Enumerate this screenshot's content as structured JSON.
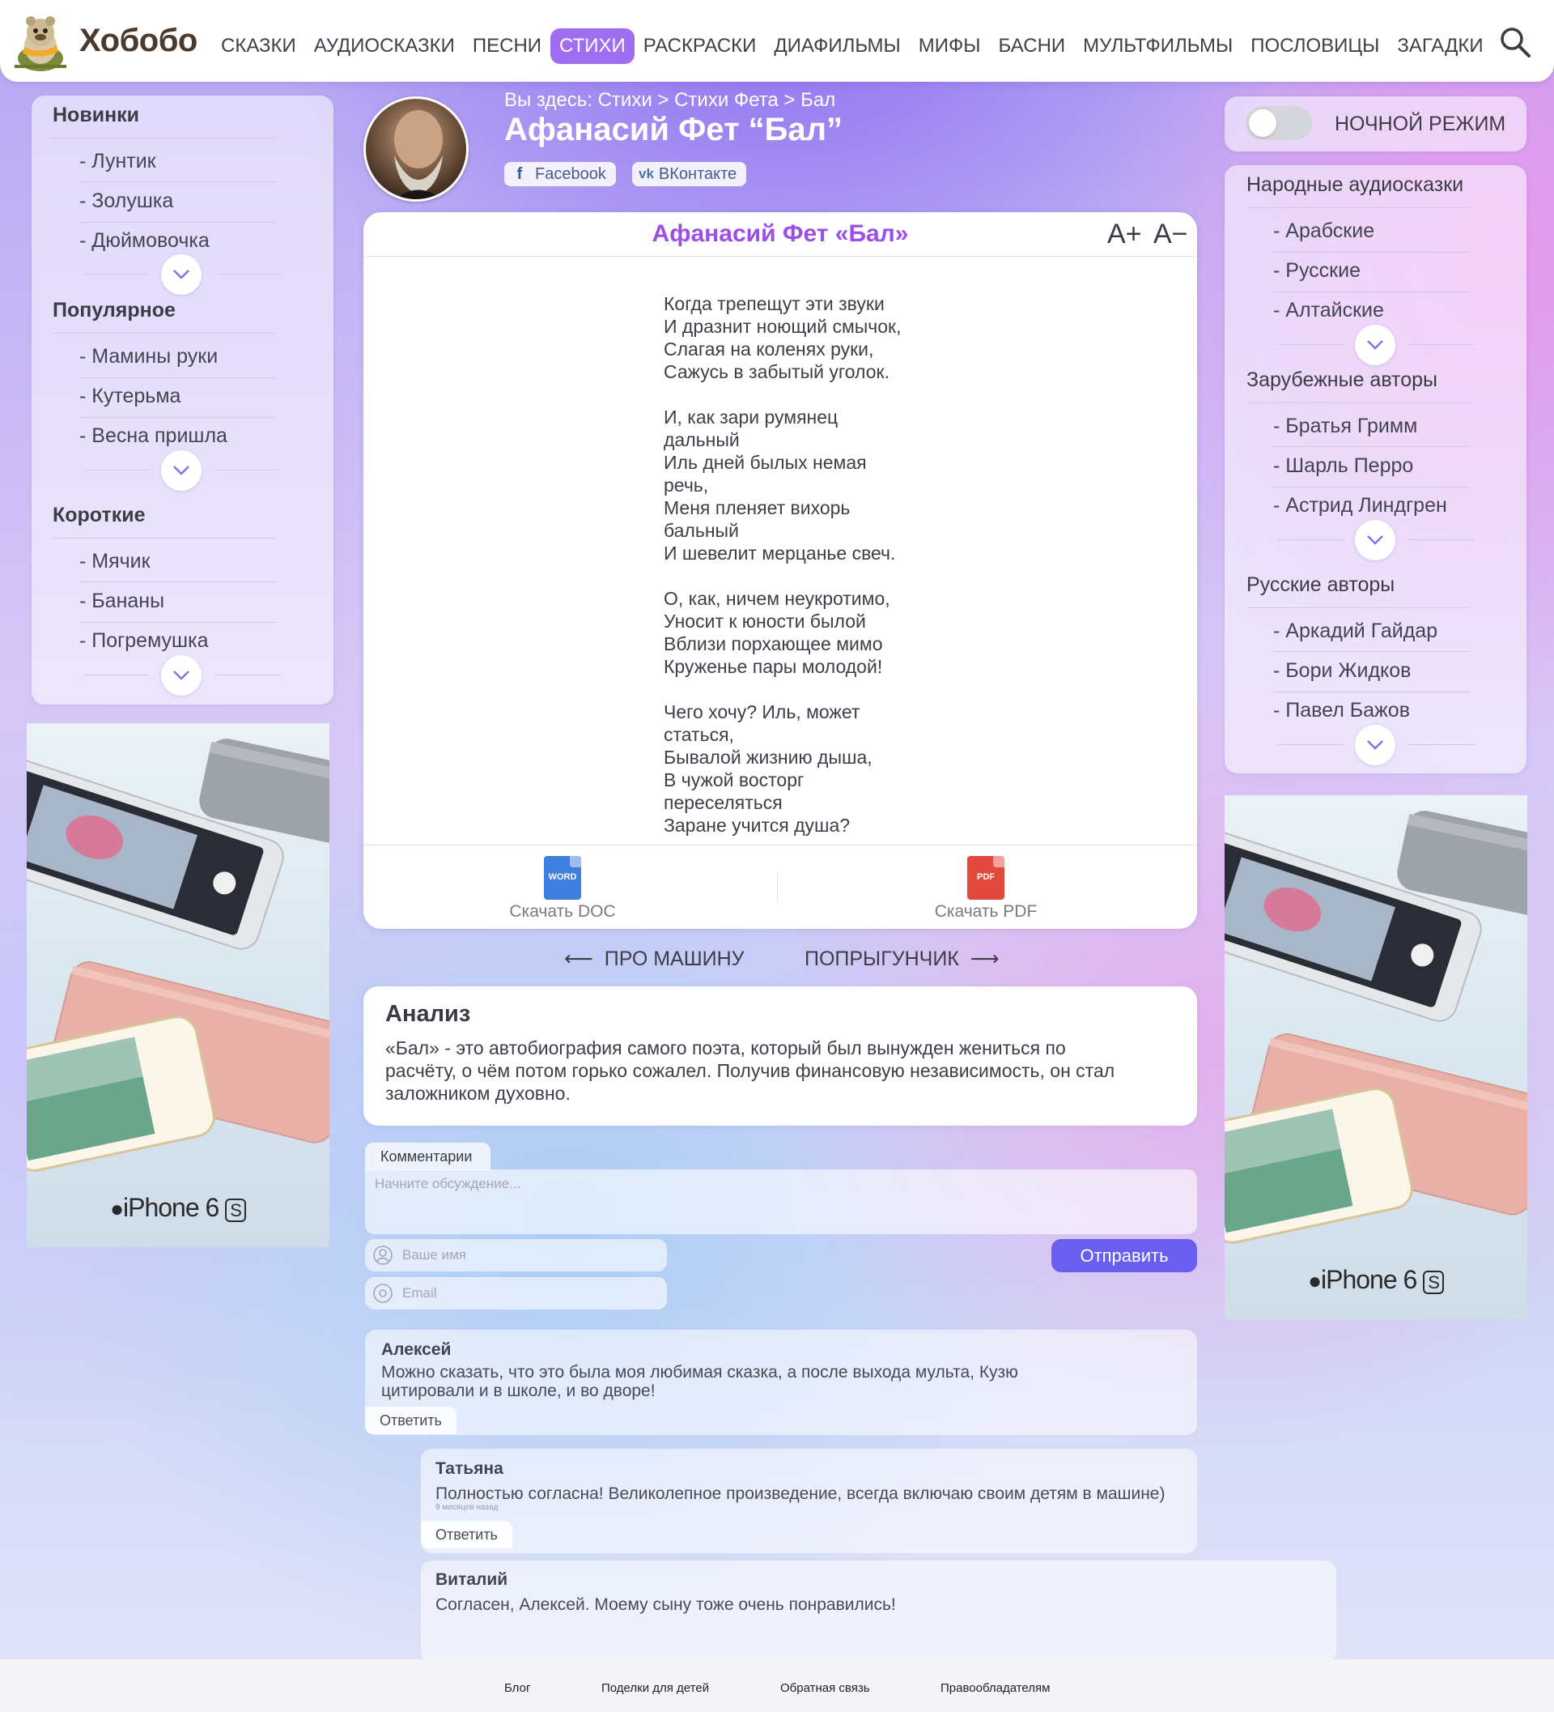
{
  "brand": {
    "name": "Хобобо"
  },
  "nav": {
    "items": [
      "СКАЗКИ",
      "АУДИОСКАЗКИ",
      "ПЕСНИ",
      "СТИХИ",
      "РАСКРАСКИ",
      "ДИАФИЛЬМЫ",
      "МИФЫ",
      "БАСНИ",
      "МУЛЬТФИЛЬМЫ",
      "ПОСЛОВИЦЫ",
      "ЗАГАДКИ"
    ],
    "active": "СТИХИ",
    "search_icon": "search-icon"
  },
  "left_sidebar": {
    "sections": [
      {
        "title": "Новинки",
        "items": [
          "- Лунтик",
          "- Золушка",
          "- Дюймовочка"
        ]
      },
      {
        "title": "Популярное",
        "items": [
          "- Мамины руки",
          "- Кутерьма",
          "- Весна пришла"
        ]
      },
      {
        "title": "Короткие",
        "items": [
          "- Мячик",
          "- Бананы",
          "- Погремушка"
        ]
      }
    ]
  },
  "right_sidebar": {
    "night_mode_label": "НОЧНОЙ РЕЖИМ",
    "night_mode_on": false,
    "sections": [
      {
        "title": "Народные аудиосказки",
        "items": [
          "- Арабские",
          "- Русские",
          "- Алтайские"
        ]
      },
      {
        "title": "Зарубежные авторы",
        "items": [
          "- Братья Гримм",
          "- Шарль Перро",
          "- Астрид Линдгрен"
        ]
      },
      {
        "title": "Русские авторы",
        "items": [
          "- Аркадий Гайдар",
          "- Бори Жидков",
          "- Павел Бажов"
        ]
      }
    ]
  },
  "ads": {
    "label": "iPhone 6",
    "badge": "S"
  },
  "header": {
    "breadcrumb": "Вы здесь: Стихи > Стихи Фета > Бал",
    "title": "Афанасий Фет “Бал”",
    "share": [
      "Facebook",
      "ВКонтакте"
    ]
  },
  "poem": {
    "title": "Афанасий Фет «Бал»",
    "font_increase": "A+",
    "font_decrease": "A−",
    "stanzas": [
      [
        "Когда трепещут эти звуки",
        "И дразнит ноющий смычок,",
        "Слагая на коленях руки,",
        "Сажусь в забытый уголок."
      ],
      [
        "И, как зари румянец",
        "дальный",
        "Иль дней былых немая",
        "речь,",
        "Меня пленяет вихорь",
        "бальный",
        "И шевелит мерцанье свеч."
      ],
      [
        "О, как, ничем неукротимо,",
        "Уносит к юности былой",
        "Вблизи порхающее мимо",
        "Круженье пары молодой!"
      ],
      [
        "Чего хочу? Иль, может",
        "статься,",
        "Бывалой жизнию дыша,",
        "В чужой восторг",
        "переселяться",
        "Заране учится душа?"
      ]
    ],
    "download_doc": "Скачать DOC",
    "download_pdf": "Скачать PDF",
    "doc_badge": "WORD",
    "pdf_badge": "PDF"
  },
  "pager": {
    "prev": "ПРО МАШИНУ",
    "next": "ПОПРЫГУНЧИК"
  },
  "analysis": {
    "title": "Анализ",
    "text": "«Бал» - это автобиография самого поэта, который был вынужден жениться по расчёту, о чём потом горько сожалел. Получив финансовую независимость, он стал заложником духовно."
  },
  "comment_form": {
    "tab": "Комментарии",
    "placeholder": "Начните обсуждение...",
    "name_placeholder": "Ваше имя",
    "email_placeholder": "Email",
    "submit": "Отправить"
  },
  "comments": [
    {
      "author": "Алексей",
      "text": "Можно сказать, что это была моя любимая сказка, а после выхода мульта, Кузю цитировали и в школе, и во дворе!",
      "time": "",
      "reply": "Ответить"
    },
    {
      "author": "Татьяна",
      "text": "Полностью согласна! Великолепное произведение, всегда включаю своим детям в машине)",
      "time": "9 месяцев назад",
      "reply": "Ответить"
    },
    {
      "author": "Виталий",
      "text": "Согласен, Алексей. Моему сыну тоже очень понравились!",
      "time": "",
      "reply": ""
    }
  ],
  "footer": {
    "links": [
      "Блог",
      "Поделки для детей",
      "Обратная связь",
      "Правообладателям"
    ]
  },
  "colors": {
    "accent": "#a06ef0",
    "submit": "#6a5ef0",
    "poem_title": "#9a4fe8"
  }
}
